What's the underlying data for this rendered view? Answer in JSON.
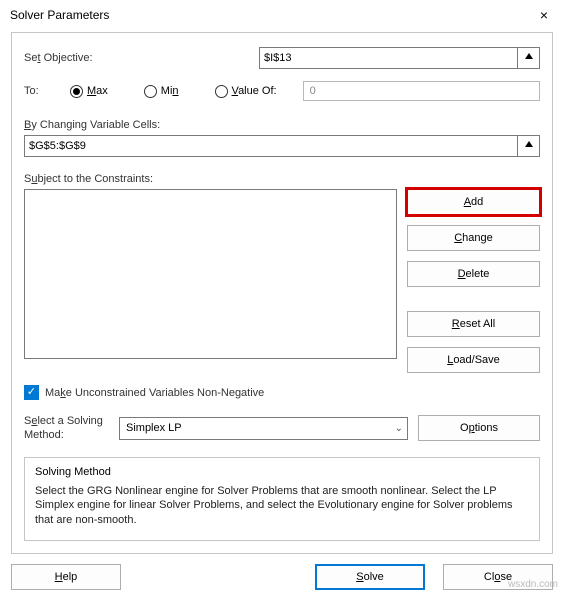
{
  "title": "Solver Parameters",
  "close_icon": "×",
  "objective": {
    "label_pre": "Se",
    "label_u": "t",
    "label_post": " Objective:",
    "value": "$I$13"
  },
  "to": {
    "label": "To:",
    "max_u": "M",
    "max_post": "ax",
    "min_pre": "Mi",
    "min_u": "n",
    "value_u": "V",
    "value_post": "alue Of:",
    "value_input": "0"
  },
  "by": {
    "label_u": "B",
    "label_post": "y Changing Variable Cells:",
    "value": "$G$5:$G$9"
  },
  "constraints": {
    "label_pre": "S",
    "label_u": "u",
    "label_post": "bject to the Constraints:"
  },
  "buttons": {
    "add_u": "A",
    "add_post": "dd",
    "change_u": "C",
    "change_post": "hange",
    "delete_u": "D",
    "delete_post": "elete",
    "reset_u": "R",
    "reset_post": "eset All",
    "load_u": "L",
    "load_post": "oad/Save",
    "options_pre": "O",
    "options_u": "p",
    "options_post": "tions"
  },
  "checkbox": {
    "label_pre": "Ma",
    "label_u": "k",
    "label_post": "e Unconstrained Variables Non-Negative"
  },
  "method": {
    "label_pre": "S",
    "label_u": "e",
    "label_post": "lect a Solving Method:",
    "selected": "Simplex LP"
  },
  "desc": {
    "title": "Solving Method",
    "text": "Select the GRG Nonlinear engine for Solver Problems that are smooth nonlinear. Select the LP Simplex engine for linear Solver Problems, and select the Evolutionary engine for Solver problems that are non-smooth."
  },
  "bottom": {
    "help_u": "H",
    "help_post": "elp",
    "solve_u": "S",
    "solve_post": "olve",
    "close_pre": "Cl",
    "close_u": "o",
    "close_post": "se"
  },
  "watermark": "wsxdn.com"
}
